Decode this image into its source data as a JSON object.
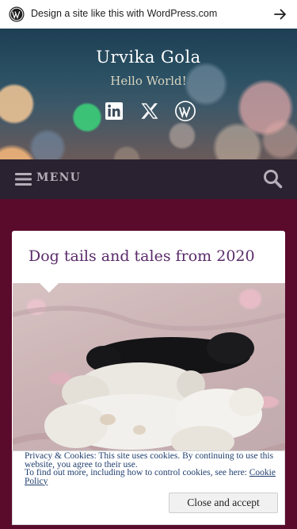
{
  "banner": {
    "text": "Design a site like this with WordPress.com"
  },
  "header": {
    "site_title": "Urvika Gola",
    "tagline": "Hello World!",
    "social": [
      "linkedin-icon",
      "x-icon",
      "wordpress-icon"
    ]
  },
  "nav": {
    "menu_label": "MENU"
  },
  "post": {
    "title": "Dog tails and tales from 2020"
  },
  "cookie": {
    "line1": "Privacy & Cookies: This site uses cookies. By continuing to use this website, you agree to their use.",
    "line2": "To find out more, including how to control cookies, see here:",
    "policy_link": "Cookie Policy",
    "close_button": "Close and accept"
  },
  "colors": {
    "page_bg": "#5a0b2c",
    "nav_bg": "#2a2230",
    "post_title": "#5a2a6a",
    "cookie_text": "#1f3e6e"
  }
}
